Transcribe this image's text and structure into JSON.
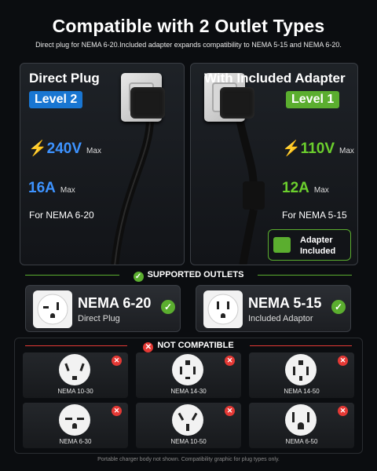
{
  "header": {
    "title": "Compatible with 2 Outlet Types",
    "subtitle": "Direct plug for NEMA 6-20.Included adapter expands compatibility to NEMA 5-15 and NEMA 6-20."
  },
  "direct": {
    "title": "Direct Plug",
    "level": "Level 2",
    "voltage": "240V",
    "voltage_unit": "Max",
    "current": "16A",
    "current_unit": "Max",
    "for": "For NEMA 6-20"
  },
  "adapter": {
    "title": "With Included Adapter",
    "level": "Level 1",
    "voltage": "110V",
    "voltage_unit": "Max",
    "current": "12A",
    "current_unit": "Max",
    "for": "For NEMA 5-15",
    "badge_line1": "Adapter",
    "badge_line2": "Included"
  },
  "supported": {
    "heading": "SUPPORTED OUTLETS",
    "items": [
      {
        "name": "NEMA 6-20",
        "desc": "Direct Plug"
      },
      {
        "name": "NEMA 5-15",
        "desc": "Included Adaptor"
      }
    ]
  },
  "not_compatible": {
    "heading": "NOT COMPATIBLE",
    "items": [
      "NEMA 10-30",
      "NEMA 14-30",
      "NEMA 14-50",
      "NEMA 6-30",
      "NEMA 10-50",
      "NEMA 6-50"
    ]
  },
  "footer": "Portable charger body not shown. Compatibility graphic for plug types only.",
  "colors": {
    "blue": "#3d93ff",
    "green": "#5bae2f",
    "red": "#e53935"
  }
}
